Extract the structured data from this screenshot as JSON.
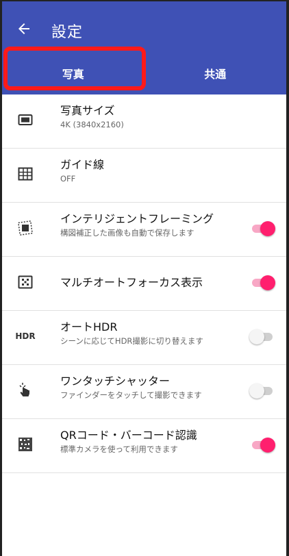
{
  "appbar": {
    "title": "設定"
  },
  "tabs": [
    {
      "label": "写真"
    },
    {
      "label": "共通"
    }
  ],
  "items": [
    {
      "title": "写真サイズ",
      "subtitle": "4K (3840x2160)"
    },
    {
      "title": "ガイド線",
      "subtitle": "OFF"
    },
    {
      "title": "インテリジェントフレーミング",
      "subtitle": "構図補正した画像も自動で保存します",
      "toggle": "on"
    },
    {
      "title": "マルチオートフォーカス表示",
      "subtitle": "",
      "toggle": "on"
    },
    {
      "title": "オートHDR",
      "subtitle": "シーンに応じてHDR撮影に切り替えます",
      "toggle": "off",
      "icon_text": "HDR"
    },
    {
      "title": "ワンタッチシャッター",
      "subtitle": "ファインダーをタッチして撮影できます",
      "toggle": "off"
    },
    {
      "title": "QRコード・バーコード認識",
      "subtitle": "標準カメラを使って利用できます",
      "toggle": "on"
    }
  ],
  "colors": {
    "primary": "#3f51b5",
    "accent": "#ff1f6e",
    "highlight": "#ff1a1a"
  }
}
